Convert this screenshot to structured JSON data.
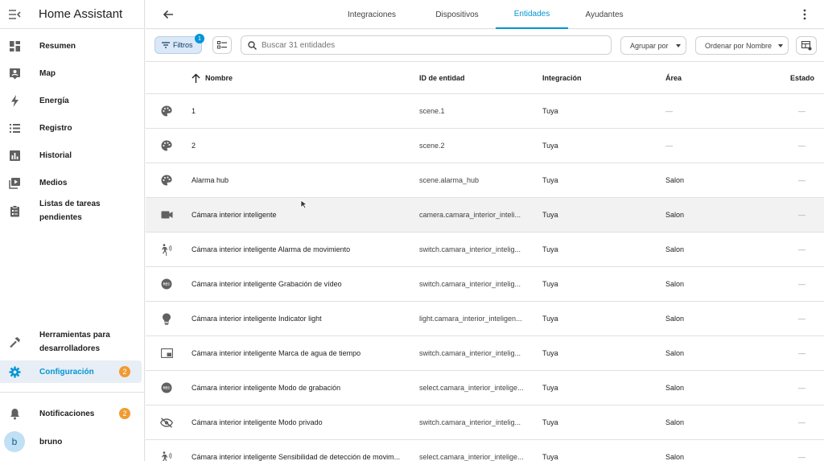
{
  "sidebar": {
    "app_title": "Home Assistant",
    "items": [
      {
        "label": "Resumen",
        "icon": "dashboard-icon"
      },
      {
        "label": "Map",
        "icon": "map-icon"
      },
      {
        "label": "Energía",
        "icon": "lightning-icon"
      },
      {
        "label": "Registro",
        "icon": "list-icon"
      },
      {
        "label": "Historial",
        "icon": "chart-icon"
      },
      {
        "label": "Medios",
        "icon": "media-icon"
      },
      {
        "label": "Listas de tareas pendientes",
        "icon": "clipboard-icon"
      }
    ],
    "developer_tools": {
      "label": "Herramientas para desarrolladores",
      "icon": "hammer-icon"
    },
    "settings": {
      "label": "Configuración",
      "badge": "2",
      "icon": "gear-icon"
    },
    "notifications": {
      "label": "Notificaciones",
      "badge": "2",
      "icon": "bell-icon"
    },
    "user": {
      "initial": "b",
      "name": "bruno"
    }
  },
  "tabs": [
    {
      "label": "Integraciones",
      "active": false
    },
    {
      "label": "Dispositivos",
      "active": false
    },
    {
      "label": "Entidades",
      "active": true
    },
    {
      "label": "Ayudantes",
      "active": false
    }
  ],
  "toolbar": {
    "filters_label": "Filtros",
    "filters_count": "1",
    "search_placeholder": "Buscar 31 entidades",
    "group_by_label": "Agrupar por",
    "sort_label": "Ordenar por Nombre"
  },
  "table": {
    "columns": {
      "name": "Nombre",
      "entity_id": "ID de entidad",
      "integration": "Integración",
      "area": "Área",
      "status": "Estado"
    },
    "rows": [
      {
        "icon": "palette-icon",
        "name": "1",
        "entity_id": "scene.1",
        "integration": "Tuya",
        "area": "—",
        "status": "—"
      },
      {
        "icon": "palette-icon",
        "name": "2",
        "entity_id": "scene.2",
        "integration": "Tuya",
        "area": "—",
        "status": "—"
      },
      {
        "icon": "palette-icon",
        "name": "Alarma hub",
        "entity_id": "scene.alarma_hub",
        "integration": "Tuya",
        "area": "Salon",
        "status": "—"
      },
      {
        "icon": "video-camera-icon",
        "name": "Cámara interior inteligente",
        "entity_id": "camera.camara_interior_inteli...",
        "integration": "Tuya",
        "area": "Salon",
        "status": "—"
      },
      {
        "icon": "motion-sensor-icon",
        "name": "Cámara interior inteligente Alarma de movimiento",
        "entity_id": "switch.camara_interior_intelig...",
        "integration": "Tuya",
        "area": "Salon",
        "status": "—"
      },
      {
        "icon": "record-icon",
        "name": "Cámara interior inteligente Grabación de vídeo",
        "entity_id": "switch.camara_interior_intelig...",
        "integration": "Tuya",
        "area": "Salon",
        "status": "—"
      },
      {
        "icon": "lightbulb-icon",
        "name": "Cámara interior inteligente Indicator light",
        "entity_id": "light.camara_interior_inteligen...",
        "integration": "Tuya",
        "area": "Salon",
        "status": "—"
      },
      {
        "icon": "picture-in-picture-icon",
        "name": "Cámara interior inteligente Marca de agua de tiempo",
        "entity_id": "switch.camara_interior_intelig...",
        "integration": "Tuya",
        "area": "Salon",
        "status": "—"
      },
      {
        "icon": "record-icon",
        "name": "Cámara interior inteligente Modo de grabación",
        "entity_id": "select.camara_interior_intelige...",
        "integration": "Tuya",
        "area": "Salon",
        "status": "—"
      },
      {
        "icon": "eye-off-icon",
        "name": "Cámara interior inteligente Modo privado",
        "entity_id": "switch.camara_interior_intelig...",
        "integration": "Tuya",
        "area": "Salon",
        "status": "—"
      },
      {
        "icon": "motion-sensor-icon",
        "name": "Cámara interior inteligente Sensibilidad de detección de movim...",
        "entity_id": "select.camara_interior_intelige...",
        "integration": "Tuya",
        "area": "Salon",
        "status": "—"
      }
    ]
  },
  "colors": {
    "accent": "#0395d5",
    "badge": "#f09b32"
  }
}
